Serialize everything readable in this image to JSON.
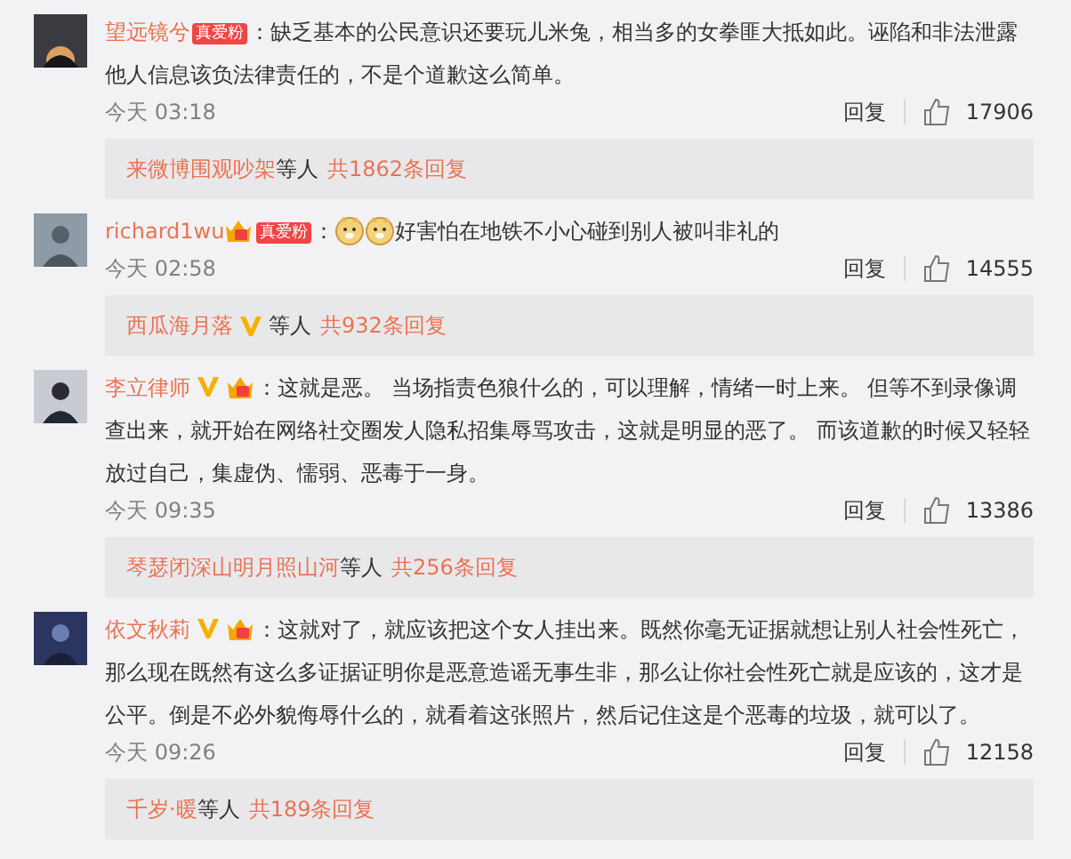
{
  "comments": [
    {
      "author": "望远镜兮",
      "badges": [
        {
          "kind": "fan",
          "text": "真爱粉"
        }
      ],
      "text": "：缺乏基本的公民意识还要玩儿米兔，相当多的女拳匪大抵如此。诬陷和非法泄露他人信息该负法律责任的，不是个道歉这么简单。",
      "time": "今天 03:18",
      "reply_label": "回复",
      "likes": "17906",
      "replies": {
        "names": [
          {
            "name": "来微博围观吵架",
            "verified": false
          }
        ],
        "joiner": "等人",
        "total": "共1862条回复"
      }
    },
    {
      "author": "richard1wu",
      "badges": [
        {
          "kind": "crown"
        },
        {
          "kind": "fan",
          "text": "真爱粉"
        }
      ],
      "emojis": [
        {
          "kind": "dog"
        },
        {
          "kind": "dog"
        }
      ],
      "text": "：",
      "after_emoji": "好害怕在地铁不小心碰到别人被叫非礼的",
      "time": "今天 02:58",
      "reply_label": "回复",
      "likes": "14555",
      "replies": {
        "names": [
          {
            "name": "西瓜海月落",
            "verified": true
          }
        ],
        "joiner": "等人",
        "total": "共932条回复"
      }
    },
    {
      "author": "李立律师",
      "badges": [
        {
          "kind": "verified"
        },
        {
          "kind": "crown"
        }
      ],
      "text": "：这就是恶。 当场指责色狼什么的，可以理解，情绪一时上来。 但等不到录像调查出来，就开始在网络社交圈发人隐私招集辱骂攻击，这就是明显的恶了。 而该道歉的时候又轻轻放过自己，集虚伪、懦弱、恶毒于一身。",
      "time": "今天 09:35",
      "reply_label": "回复",
      "likes": "13386",
      "replies": {
        "names": [
          {
            "name": "琴瑟闭深山明月照山河",
            "verified": false
          }
        ],
        "joiner": "等人",
        "total": "共256条回复"
      }
    },
    {
      "author": "依文秋莉",
      "badges": [
        {
          "kind": "verified"
        },
        {
          "kind": "crown"
        }
      ],
      "text": "：这就对了，就应该把这个女人挂出来。既然你毫无证据就想让别人社会性死亡，那么现在既然有这么多证据证明你是恶意造谣无事生非，那么让你社会性死亡就是应该的，这才是公平。倒是不必外貌侮辱什么的，就看着这张照片，然后记住这是个恶毒的垃圾，就可以了。",
      "time": "今天 09:26",
      "reply_label": "回复",
      "likes": "12158",
      "replies": {
        "names": [
          {
            "name": "千岁·暖",
            "verified": false
          }
        ],
        "joiner": "等人",
        "total": "共189条回复"
      }
    }
  ]
}
